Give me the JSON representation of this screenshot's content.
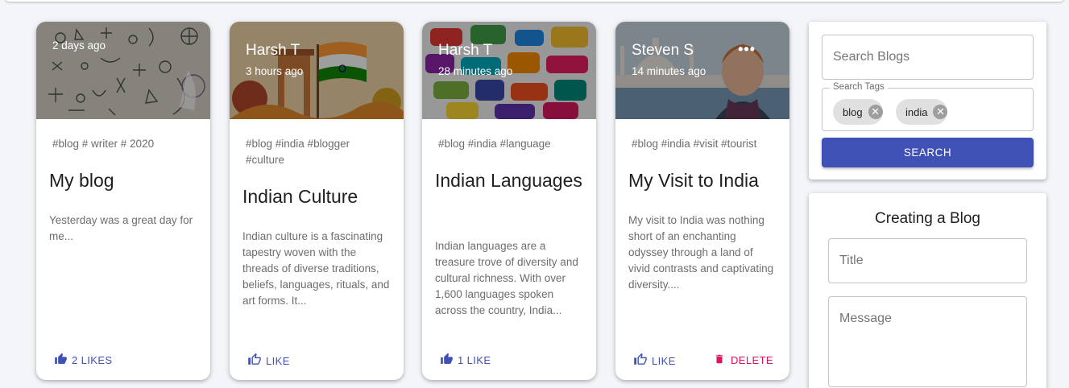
{
  "colors": {
    "primary": "#3f51b5",
    "danger": "#e0115f",
    "background": "#f4f5f9"
  },
  "posts": [
    {
      "author": "",
      "time": "2 days ago",
      "tags": "#blog # writer # 2020",
      "title": "My blog",
      "message": "Yesterday was a great day for me...",
      "like_label": "2 LIKES",
      "like_icon": "thumb-up-filled-icon"
    },
    {
      "author": "Harsh T",
      "time": "3 hours ago",
      "tags": "#blog #india #blogger #culture",
      "title": "Indian Culture",
      "message": "Indian culture is a fascinating tapestry woven with the threads of diverse traditions, beliefs, languages, rituals, and art forms. It...",
      "like_label": "LIKE",
      "like_icon": "thumb-up-outline-icon"
    },
    {
      "author": "Harsh T",
      "time": "28 minutes ago",
      "tags": "#blog #india #language",
      "title": "Indian Languages",
      "message": "Indian languages are a treasure trove of diversity and cultural richness. With over 1,600 languages spoken across the country, India...",
      "like_label": "1 LIKE",
      "like_icon": "thumb-up-filled-icon"
    },
    {
      "author": "Steven S",
      "time": "14 minutes ago",
      "tags": "#blog #india #visit #tourist",
      "title": "My Visit to India",
      "message": "My visit to India was nothing short of an enchanting odyssey through a land of vivid contrasts and captivating diversity....",
      "like_label": "LIKE",
      "like_icon": "thumb-up-outline-icon",
      "more_label": "•••",
      "delete_label": "DELETE"
    }
  ],
  "search": {
    "placeholder": "Search Blogs",
    "tags_label": "Search Tags",
    "chips": [
      "blog",
      "india"
    ],
    "button_label": "SEARCH"
  },
  "create": {
    "heading": "Creating a Blog",
    "title_placeholder": "Title",
    "message_placeholder": "Message"
  }
}
